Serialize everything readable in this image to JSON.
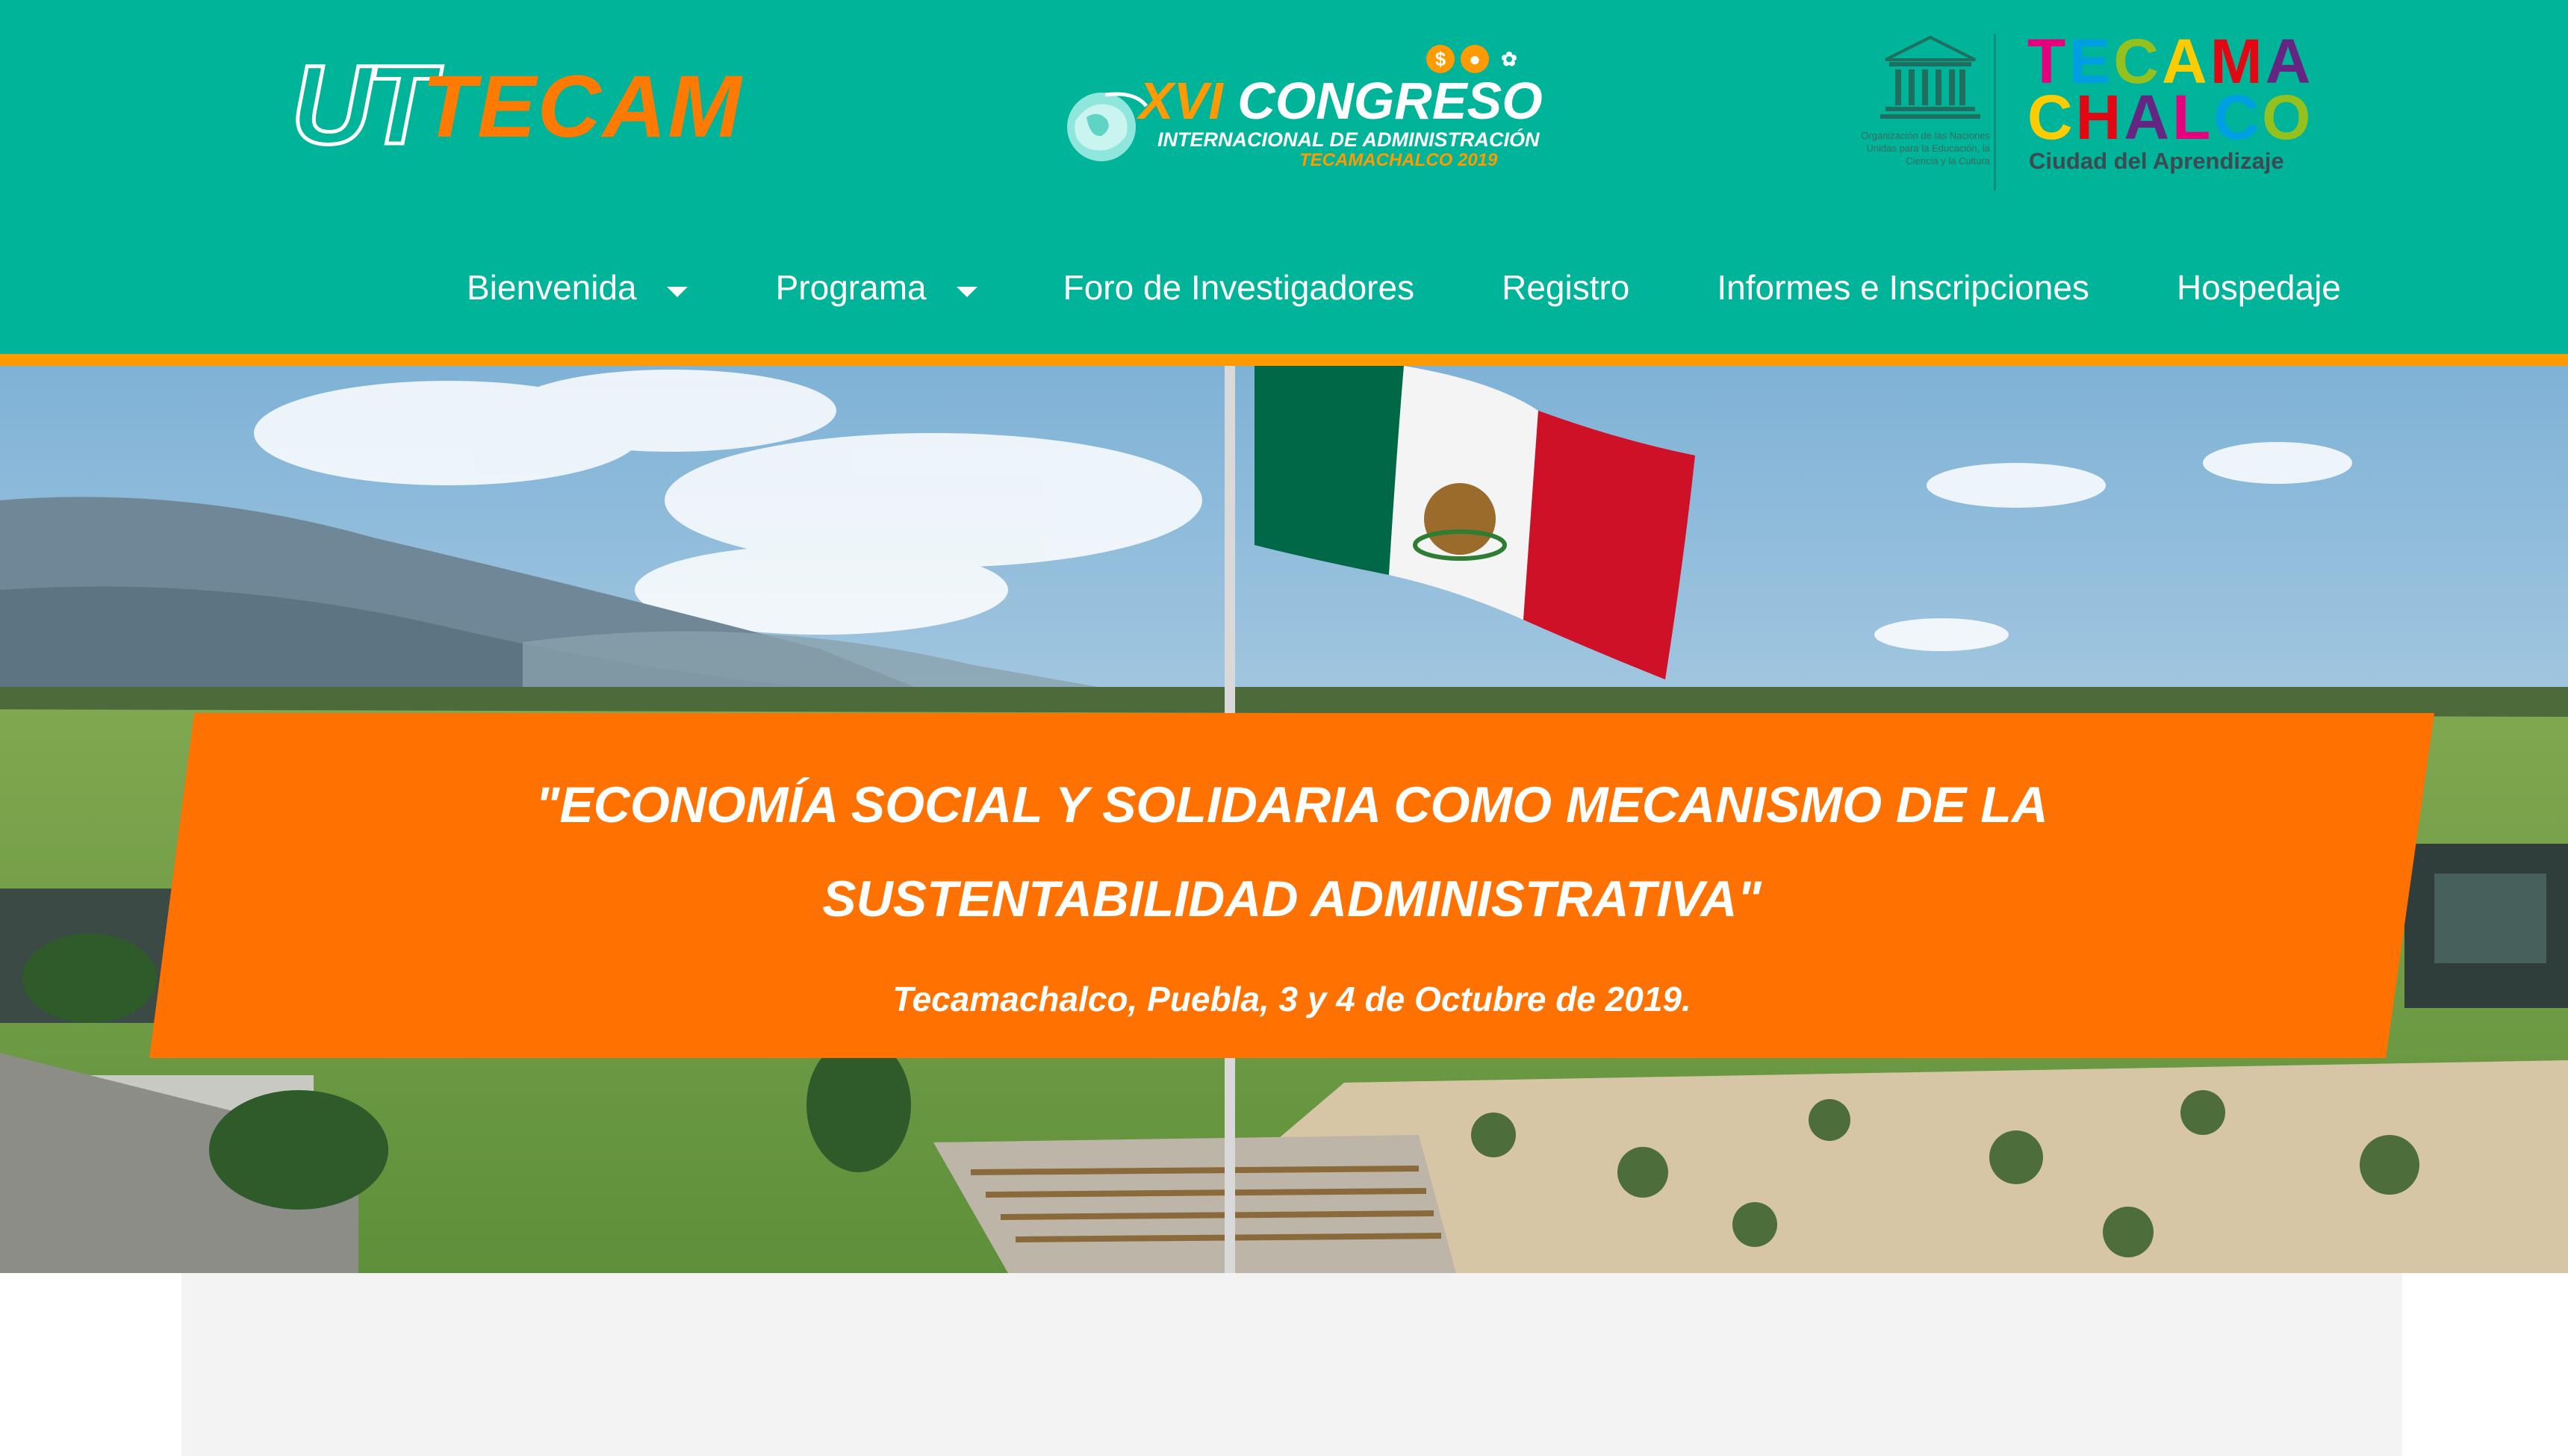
{
  "header": {
    "logo_left": {
      "ut": "UT",
      "tecam": "TECAM"
    },
    "logo_center": {
      "numeral": "XVI",
      "word": "CONGRESO",
      "line2": "INTERNACIONAL DE ADMINISTRACIÓN",
      "line3": "TECAMACHALCO 2019",
      "icons": [
        "coin-icon",
        "people-icon",
        "plant-icon"
      ]
    },
    "logo_right": {
      "unesco_caption": "Organización de las Naciones Unidas para la Educación, la Ciencia y la Cultura",
      "word1": "TECAMA",
      "word2": "CHALCO",
      "subtitle": "Ciudad del Aprendizaje",
      "colors": [
        "#e6007e",
        "#009fe3",
        "#95c11f",
        "#ffcc00",
        "#e30613",
        "#662483"
      ]
    }
  },
  "nav": {
    "items": [
      {
        "label": "Bienvenida",
        "dropdown": true
      },
      {
        "label": "Programa",
        "dropdown": true
      },
      {
        "label": "Foro de Investigadores",
        "dropdown": false
      },
      {
        "label": "Registro",
        "dropdown": false
      },
      {
        "label": "Informes e Inscripciones",
        "dropdown": false
      },
      {
        "label": "Hospedaje",
        "dropdown": false
      }
    ]
  },
  "hero": {
    "title_line1": "\"ECONOMÍA SOCIAL Y SOLIDARIA COMO MECANISMO DE LA",
    "title_line2": "SUSTENTABILIDAD ADMINISTRATIVA\"",
    "subtitle": "Tecamachalco, Puebla, 3 y 4 de Octubre de 2019."
  },
  "colors": {
    "header_bg": "#00b499",
    "accent_orange": "#ff7100",
    "rule_orange": "#ff9a00",
    "flag_green": "#006847",
    "flag_red": "#ce1126"
  }
}
